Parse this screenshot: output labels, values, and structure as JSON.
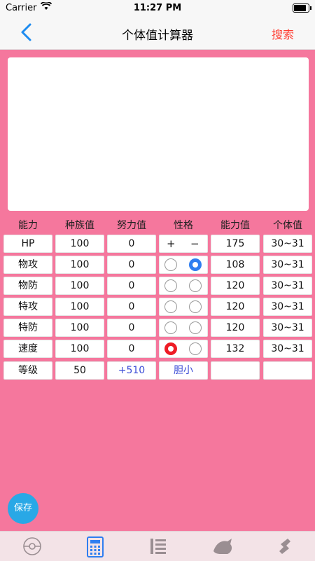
{
  "status": {
    "carrier": "Carrier",
    "time": "11:27 PM",
    "battery_level": 0.85
  },
  "nav": {
    "title": "个体值计算器",
    "search_label": "搜索"
  },
  "headers": [
    "能力",
    "种族值",
    "努力值",
    "性格",
    "能力值",
    "个体值"
  ],
  "rows": [
    {
      "label": "HP",
      "base": "100",
      "ev": "0",
      "nature_plus": "+",
      "nature_minus": "−",
      "stat": "175",
      "iv": "30~31"
    },
    {
      "label": "物攻",
      "base": "100",
      "ev": "0",
      "stat": "108",
      "iv": "30~31",
      "radio_selected": "right"
    },
    {
      "label": "物防",
      "base": "100",
      "ev": "0",
      "stat": "120",
      "iv": "30~31",
      "radio_selected": "none"
    },
    {
      "label": "特攻",
      "base": "100",
      "ev": "0",
      "stat": "120",
      "iv": "30~31",
      "radio_selected": "none"
    },
    {
      "label": "特防",
      "base": "100",
      "ev": "0",
      "stat": "120",
      "iv": "30~31",
      "radio_selected": "none"
    },
    {
      "label": "速度",
      "base": "100",
      "ev": "0",
      "stat": "132",
      "iv": "30~31",
      "radio_selected": "left"
    }
  ],
  "level_row": {
    "label": "等级",
    "level": "50",
    "ev_remaining": "+510",
    "nature": "胆小"
  },
  "save_label": "保存",
  "colors": {
    "main_bg": "#f5779d",
    "increase": "#2f7ef0",
    "decrease": "#ee1c25",
    "accent": "#ff3b30"
  },
  "tabs": [
    {
      "icon": "pokeball-icon"
    },
    {
      "icon": "calculator-icon",
      "active": true
    },
    {
      "icon": "list-icon"
    },
    {
      "icon": "creature-icon"
    },
    {
      "icon": "tool-icon"
    }
  ]
}
